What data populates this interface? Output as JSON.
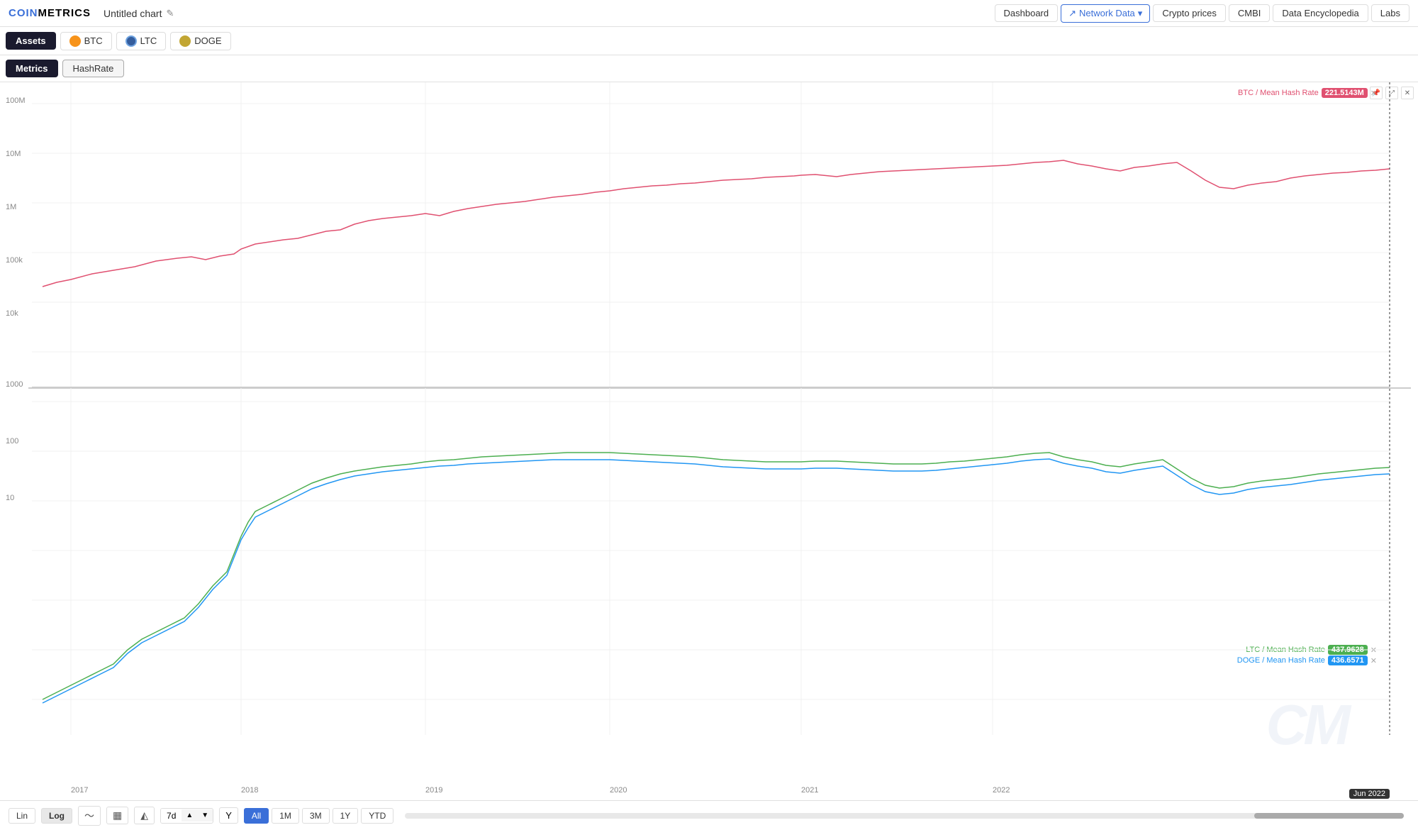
{
  "logo": {
    "text_coin": "COIN",
    "text_metrics": "METRICS"
  },
  "header": {
    "chart_title": "Untitled chart",
    "nav_items": [
      "Dashboard",
      "Network Data",
      "Crypto prices",
      "CMBI",
      "Data Encyclopedia",
      "Labs"
    ],
    "network_data_label": "Network Data"
  },
  "assets": {
    "label": "Assets",
    "items": [
      {
        "symbol": "BTC",
        "icon_type": "btc"
      },
      {
        "symbol": "LTC",
        "icon_type": "ltc"
      },
      {
        "symbol": "DOGE",
        "icon_type": "doge"
      }
    ]
  },
  "metrics": {
    "label": "Metrics",
    "items": [
      {
        "label": "HashRate",
        "active": true
      }
    ]
  },
  "chart": {
    "btc_series_label": "BTC / Mean Hash Rate",
    "btc_value": "221.5143M",
    "ltc_series_label": "LTC / Mean Hash Rate",
    "ltc_value": "437.9628",
    "doge_series_label": "DOGE / Mean Hash Rate",
    "doge_value": "436.6571",
    "y_labels_top": [
      "100M",
      "10M",
      "1M",
      "100k",
      "10k",
      "1000"
    ],
    "y_labels_bottom": [
      "100",
      "10"
    ],
    "x_labels": [
      "2017",
      "2018",
      "2019",
      "2020",
      "2021",
      "2022"
    ],
    "x_highlight": "Jun 2022",
    "watermark": "CM"
  },
  "bottom_bar": {
    "scale_lin": "Lin",
    "scale_log": "Log",
    "interval": "7d",
    "y_axis_icon": "Y",
    "time_ranges": [
      "All",
      "1M",
      "3M",
      "1Y",
      "YTD"
    ]
  },
  "icons": {
    "edit": "✎",
    "chart_line": "⌃",
    "network_arrow": "↗",
    "dropdown": "▾",
    "crosshair": "⊕",
    "pin": "📌",
    "resize": "⤢",
    "close": "✕",
    "chart_type_line": "〜",
    "chart_type_bar": "▦",
    "chart_type_area": "◭"
  }
}
